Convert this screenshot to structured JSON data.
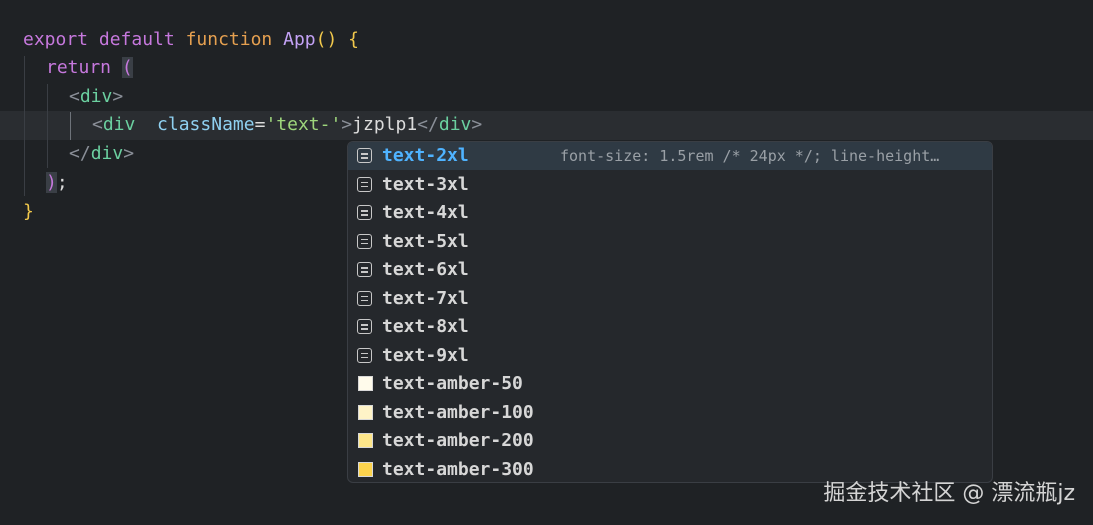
{
  "editor": {
    "lines": {
      "l1": {
        "kw1": "export",
        "kw2": "default",
        "kw3": "function",
        "name": "App",
        "parens": "()",
        "brace": "{"
      },
      "l2": {
        "kw": "return",
        "paren": "("
      },
      "l3": {
        "open": "<",
        "tag": "div",
        "close": ">"
      },
      "l4": {
        "open": "<",
        "tag": "div",
        "attr": "className",
        "eq": "=",
        "value": "'text-'",
        "gt": ">",
        "text": "jzplp1",
        "closeOpen": "</",
        "closeTag": "div",
        "closeGt": ">"
      },
      "l5": {
        "open": "</",
        "tag": "div",
        "close": ">"
      },
      "l6": {
        "paren": ")",
        "semi": ";"
      },
      "l7": {
        "brace": "}"
      }
    }
  },
  "suggest": {
    "selected_detail": "font-size: 1.5rem /* 24px */; line-height…",
    "items": [
      {
        "prefix": "text-",
        "rest": "2xl",
        "kind": "text"
      },
      {
        "prefix": "text-",
        "rest": "3xl",
        "kind": "text"
      },
      {
        "prefix": "text-",
        "rest": "4xl",
        "kind": "text"
      },
      {
        "prefix": "text-",
        "rest": "5xl",
        "kind": "text"
      },
      {
        "prefix": "text-",
        "rest": "6xl",
        "kind": "text"
      },
      {
        "prefix": "text-",
        "rest": "7xl",
        "kind": "text"
      },
      {
        "prefix": "text-",
        "rest": "8xl",
        "kind": "text"
      },
      {
        "prefix": "text-",
        "rest": "9xl",
        "kind": "text"
      },
      {
        "prefix": "text-",
        "rest": "amber-50",
        "kind": "color",
        "color": "#fffbeb"
      },
      {
        "prefix": "text-",
        "rest": "amber-100",
        "kind": "color",
        "color": "#fef3c7"
      },
      {
        "prefix": "text-",
        "rest": "amber-200",
        "kind": "color",
        "color": "#fde68a"
      },
      {
        "prefix": "text-",
        "rest": "amber-300",
        "kind": "color",
        "color": "#fcd34d"
      }
    ]
  },
  "watermark": "掘金技术社区 @ 漂流瓶jz"
}
